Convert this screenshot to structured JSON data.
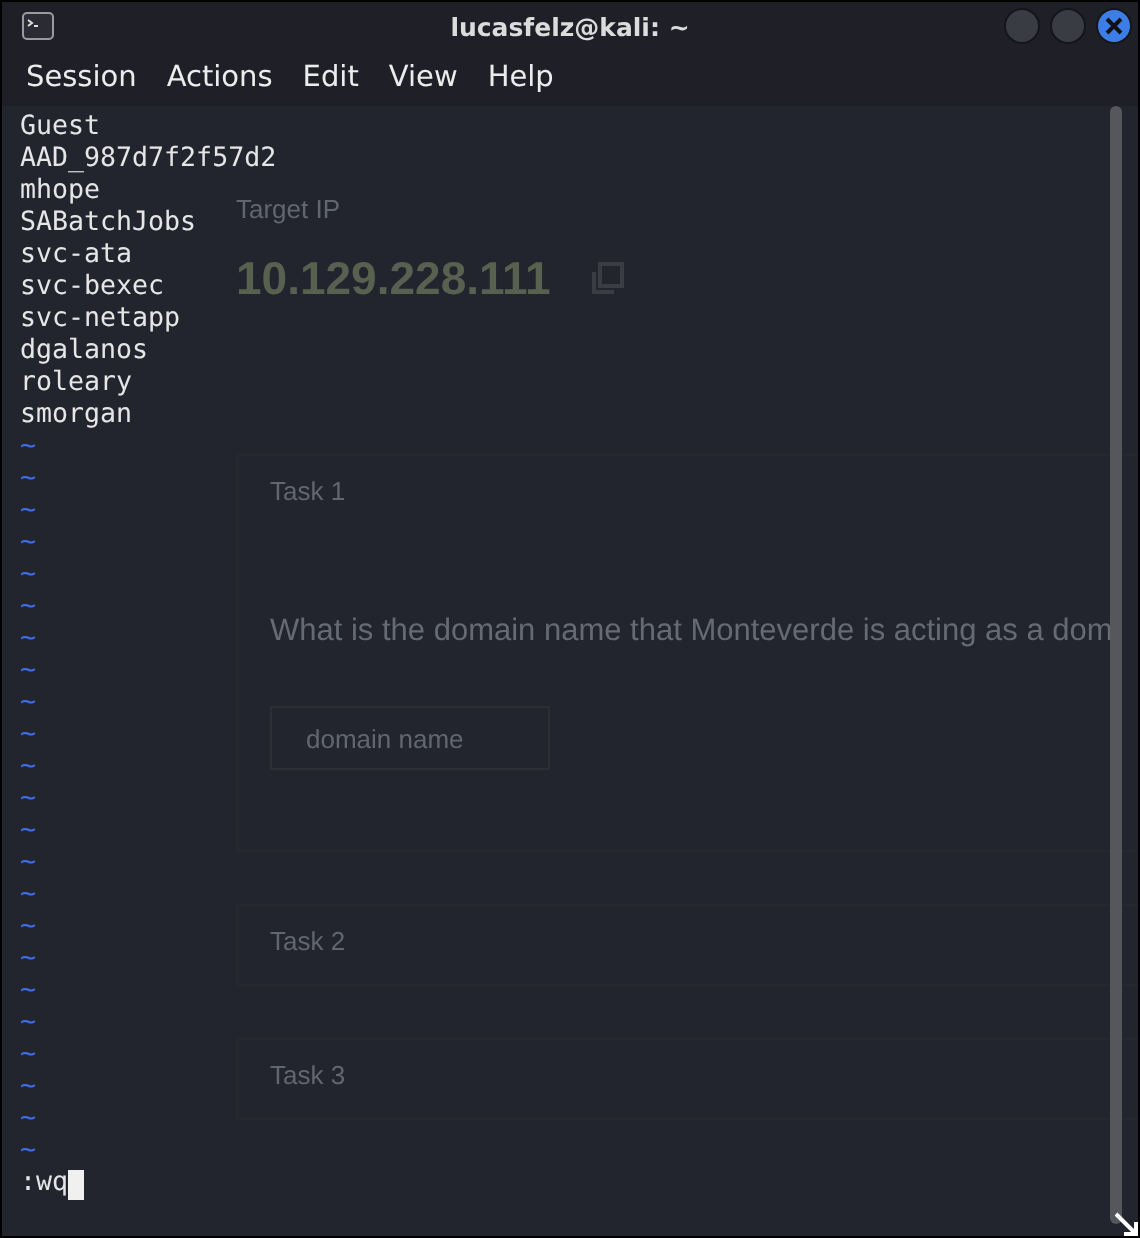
{
  "window": {
    "title": "lucasfelz@kali: ~"
  },
  "menu": [
    "Session",
    "Actions",
    "Edit",
    "View",
    "Help"
  ],
  "background_page": {
    "target_label": "Target IP",
    "target_ip": "10.129.228.111",
    "tasks": [
      {
        "title": "Task 1",
        "question": "What is the domain name that Monteverde is acting as a dom",
        "placeholder": "domain name"
      },
      {
        "title": "Task 2"
      },
      {
        "title": "Task 3"
      }
    ]
  },
  "terminal": {
    "lines": [
      "Guest",
      "AAD_987d7f2f57d2",
      "mhope",
      "SABatchJobs",
      "svc-ata",
      "svc-bexec",
      "svc-netapp",
      "dgalanos",
      "roleary",
      "smorgan"
    ],
    "filler_lines": [
      "~",
      "~",
      "~",
      "~",
      "~",
      "~",
      "~",
      "~",
      "~",
      "~",
      "~",
      "~",
      "~",
      "~",
      "~",
      "~",
      "~",
      "~",
      "~",
      "~",
      "~",
      "~",
      "~"
    ],
    "command": ":wq"
  }
}
